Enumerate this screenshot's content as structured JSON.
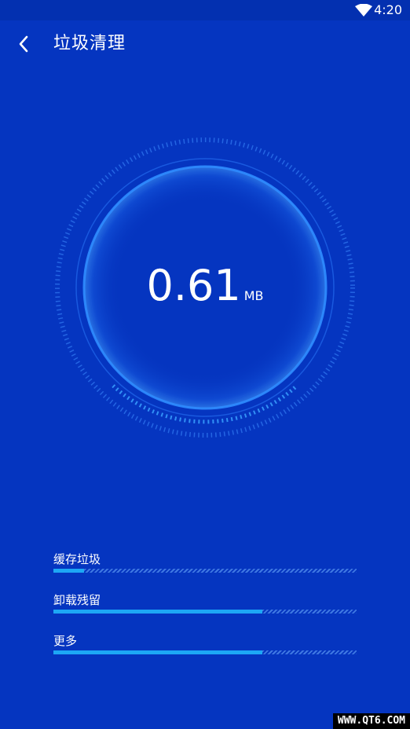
{
  "status_bar": {
    "time": "4:20",
    "wifi_icon": "wifi-icon"
  },
  "header": {
    "back_icon": "chevron-left-icon",
    "title": "垃圾清理"
  },
  "gauge": {
    "value": "0.61",
    "unit": "MB"
  },
  "scan_items": [
    {
      "label": "缓存垃圾",
      "progress": 0.1
    },
    {
      "label": "卸载残留",
      "progress": 0.69
    },
    {
      "label": "更多",
      "progress": 0.69
    }
  ],
  "watermark": "WWW.QT6.COM",
  "colors": {
    "background": "#0535c0",
    "status_bar": "#0330b0",
    "progress_fill": "#1da7f5",
    "ring": "#2f8cff"
  }
}
